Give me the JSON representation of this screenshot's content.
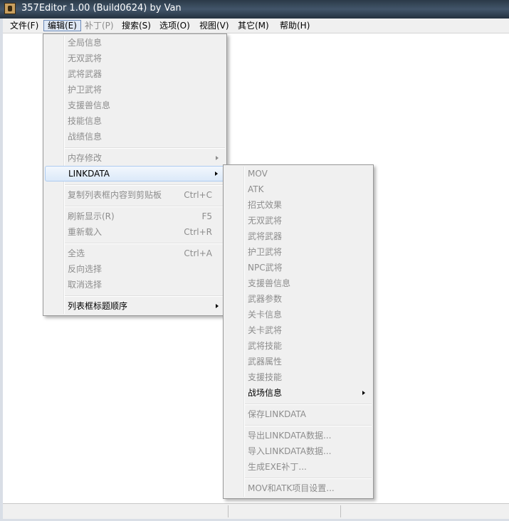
{
  "window": {
    "title": "357Editor 1.00 (Build0624) by Van"
  },
  "menubar": {
    "items": [
      {
        "label": "文件(F)"
      },
      {
        "label": "编辑(E)"
      },
      {
        "label": "补丁(P)"
      },
      {
        "label": "搜索(S)"
      },
      {
        "label": "选项(O)"
      },
      {
        "label": "视图(V)"
      },
      {
        "label": "其它(M)"
      },
      {
        "label": "帮助(H)"
      }
    ]
  },
  "edit_menu": {
    "items": [
      {
        "label": "全局信息"
      },
      {
        "label": "无双武将"
      },
      {
        "label": "武将武器"
      },
      {
        "label": "护卫武将"
      },
      {
        "label": "支援兽信息"
      },
      {
        "label": "技能信息"
      },
      {
        "label": "战绩信息"
      },
      {
        "label": "内存修改"
      },
      {
        "label": "LINKDATA"
      },
      {
        "label": "复制列表框内容到剪贴板",
        "shortcut": "Ctrl+C"
      },
      {
        "label": "刷新显示(R)",
        "shortcut": "F5"
      },
      {
        "label": "重新载入",
        "shortcut": "Ctrl+R"
      },
      {
        "label": "全选",
        "shortcut": "Ctrl+A"
      },
      {
        "label": "反向选择"
      },
      {
        "label": "取消选择"
      },
      {
        "label": "列表框标题顺序"
      }
    ]
  },
  "linkdata_menu": {
    "items": [
      {
        "label": "MOV"
      },
      {
        "label": "ATK"
      },
      {
        "label": "招式效果"
      },
      {
        "label": "无双武将"
      },
      {
        "label": "武将武器"
      },
      {
        "label": "护卫武将"
      },
      {
        "label": "NPC武将"
      },
      {
        "label": "支援兽信息"
      },
      {
        "label": "武器参数"
      },
      {
        "label": "关卡信息"
      },
      {
        "label": "关卡武将"
      },
      {
        "label": "武将技能"
      },
      {
        "label": "武器属性"
      },
      {
        "label": "支援技能"
      },
      {
        "label": "战场信息"
      },
      {
        "label": "保存LINKDATA"
      },
      {
        "label": "导出LINKDATA数据..."
      },
      {
        "label": "导入LINKDATA数据..."
      },
      {
        "label": "生成EXE补丁..."
      },
      {
        "label": "MOV和ATK项目设置..."
      }
    ]
  }
}
